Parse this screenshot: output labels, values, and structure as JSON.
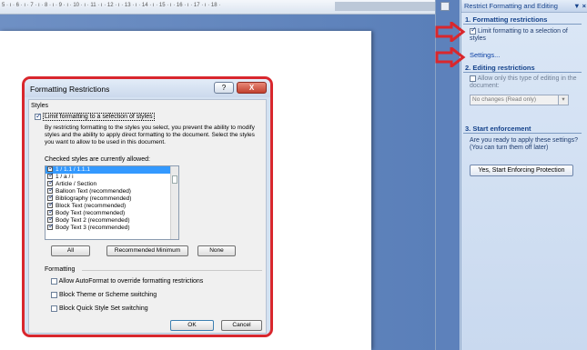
{
  "ruler": {
    "text": "5 · ı · 6 · ı · 7 · ı · 8 · ı · 9 · ı · 10 · ı · 11 · ı · 12 · ı · 13 · ı · 14 · ı · 15 · ı · 16 · ı · 17 · ı · 18 ·"
  },
  "pane": {
    "title": "Restrict Formatting and Editing",
    "title_controls": "▼ ×",
    "s1_heading": "1. Formatting restrictions",
    "s1_checkbox": "Limit formatting to a selection of styles",
    "s1_settings": "Settings...",
    "s2_heading": "2. Editing restrictions",
    "s2_checkbox": "Allow only this type of editing in the document:",
    "s2_dropdown": "No changes (Read only)",
    "s3_heading": "3. Start enforcement",
    "s3_text": "Are you ready to apply these settings? (You can turn them off later)",
    "s3_button": "Yes, Start Enforcing Protection"
  },
  "dialog": {
    "title": "Formatting Restrictions",
    "help": "?",
    "close": "X",
    "styles_label": "Styles",
    "limit_checkbox": "Limit formatting to a selection of styles",
    "description": "By restricting formatting to the styles you select, you prevent the ability to modify styles and the ability to apply direct formatting to the document. Select the styles you want to allow to be used in this document.",
    "checked_label": "Checked styles are currently allowed:",
    "styles": [
      "1 / 1.1 / 1.1.1",
      "1 / a / i",
      "Article / Section",
      "Balloon Text (recommended)",
      "Bibliography (recommended)",
      "Block Text (recommended)",
      "Body Text (recommended)",
      "Body Text 2 (recommended)",
      "Body Text 3 (recommended)"
    ],
    "btn_all": "All",
    "btn_recommended": "Recommended Minimum",
    "btn_none": "None",
    "formatting_label": "Formatting",
    "opt1": "Allow AutoFormat to override formatting restrictions",
    "opt2": "Block Theme or Scheme switching",
    "opt3": "Block Quick Style Set switching",
    "ok": "OK",
    "cancel": "Cancel"
  },
  "colors": {
    "highlight": "#d9272d",
    "selection": "#3399ff",
    "link": "#0a3fa3"
  }
}
